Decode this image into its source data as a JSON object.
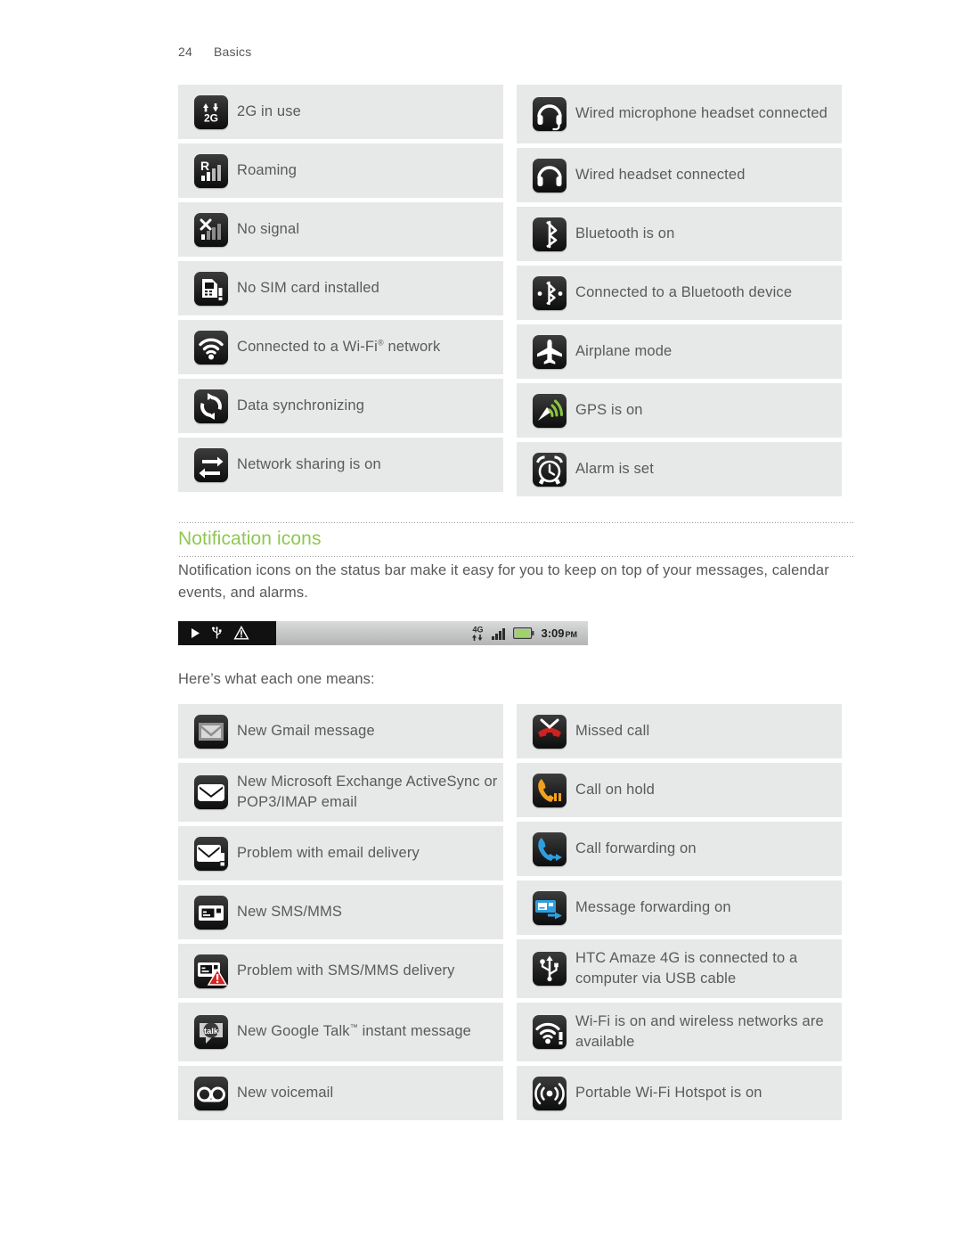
{
  "runhead": {
    "page_number": "24",
    "section": "Basics"
  },
  "status_table": {
    "left": [
      {
        "icon": "2g-in-use-icon",
        "label": "2G in use"
      },
      {
        "icon": "roaming-icon",
        "label": "Roaming"
      },
      {
        "icon": "no-signal-icon",
        "label": "No signal"
      },
      {
        "icon": "no-sim-card-icon",
        "label": "No SIM card installed"
      },
      {
        "icon": "wifi-connected-icon",
        "label": "Connected to a Wi-Fi",
        "label_sup": "®",
        "label_tail": " network"
      },
      {
        "icon": "data-sync-icon",
        "label": "Data synchronizing"
      },
      {
        "icon": "network-sharing-icon",
        "label": "Network sharing is on"
      }
    ],
    "right": [
      {
        "icon": "wired-microphone-headset-icon",
        "label": "Wired microphone headset connected"
      },
      {
        "icon": "wired-headset-icon",
        "label": "Wired headset connected"
      },
      {
        "icon": "bluetooth-on-icon",
        "label": "Bluetooth is on"
      },
      {
        "icon": "bluetooth-connected-icon",
        "label": "Connected to a Bluetooth device"
      },
      {
        "icon": "airplane-mode-icon",
        "label": "Airplane mode"
      },
      {
        "icon": "gps-on-icon",
        "label": "GPS is on"
      },
      {
        "icon": "alarm-set-icon",
        "label": "Alarm is set"
      }
    ]
  },
  "notification_section": {
    "heading": "Notification icons",
    "intro": "Notification icons on the status bar make it easy for you to keep on top of your messages, calendar events, and alarms.",
    "lead_in": "Here’s what each one means:",
    "status_bar_sample": {
      "left_icons": [
        "play-icon",
        "usb-icon",
        "alert-triangle-icon"
      ],
      "network_label": "4G",
      "right_icons": [
        "data-updown-icon",
        "signal-bars-icon",
        "battery-icon"
      ],
      "time": "3:09",
      "ampm": "PM"
    }
  },
  "notification_table": {
    "left": [
      {
        "icon": "gmail-icon",
        "label": "New Gmail message"
      },
      {
        "icon": "exchange-email-icon",
        "label": "New Microsoft Exchange ActiveSync or POP3/IMAP email"
      },
      {
        "icon": "email-problem-icon",
        "label": "Problem with email delivery"
      },
      {
        "icon": "sms-mms-icon",
        "label": "New SMS/MMS"
      },
      {
        "icon": "sms-problem-icon",
        "label": "Problem with SMS/MMS delivery"
      },
      {
        "icon": "google-talk-icon",
        "label": "New Google Talk",
        "label_sup": "™",
        "label_tail": " instant message"
      },
      {
        "icon": "voicemail-icon",
        "label": "New voicemail"
      }
    ],
    "right": [
      {
        "icon": "missed-call-icon",
        "label": "Missed call"
      },
      {
        "icon": "call-on-hold-icon",
        "label": "Call on hold"
      },
      {
        "icon": "call-forwarding-icon",
        "label": "Call forwarding on"
      },
      {
        "icon": "message-forwarding-icon",
        "label": "Message forwarding on"
      },
      {
        "icon": "usb-connected-icon",
        "label": "HTC Amaze 4G is connected to a computer via USB cable"
      },
      {
        "icon": "wifi-available-icon",
        "label": "Wi-Fi is on and wireless networks are available"
      },
      {
        "icon": "portable-hotspot-icon",
        "label": "Portable Wi-Fi Hotspot is on"
      }
    ]
  },
  "colors": {
    "heading_green": "#8ec751",
    "row_background": "#e7e9e9",
    "body_text": "#58595b",
    "icon_tile": "#101010"
  }
}
